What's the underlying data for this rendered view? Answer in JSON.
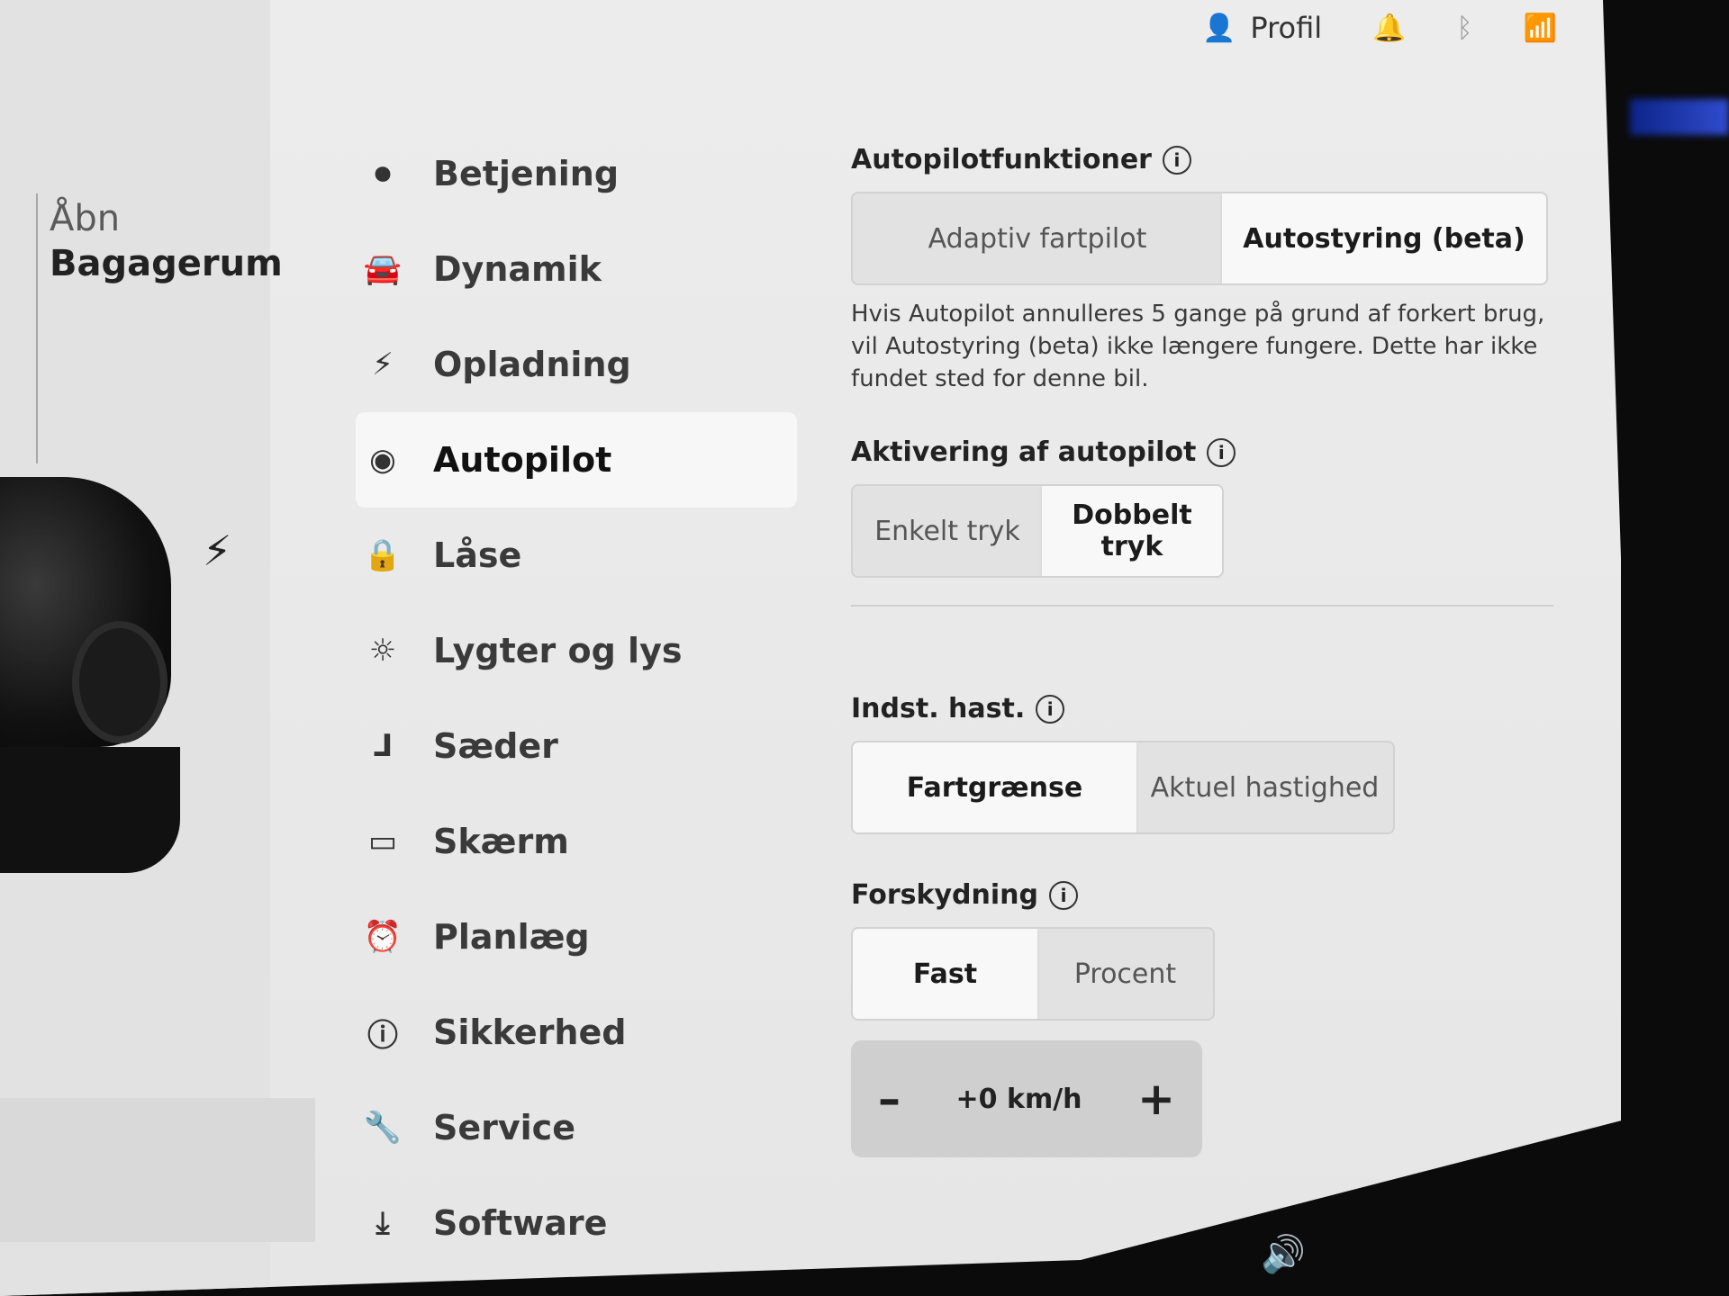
{
  "status": {
    "profile_icon": "person-icon",
    "profile_label": "Profil",
    "bell_icon": "bell-icon",
    "bluetooth_icon": "bluetooth-icon",
    "wifi_icon": "wifi-icon"
  },
  "left_panel": {
    "trunk_line1": "Åbn",
    "trunk_line2": "Bagagerum",
    "charge_icon": "lightning-icon"
  },
  "nav": {
    "items": [
      {
        "label": "Betjening",
        "icon": "toggle-icon"
      },
      {
        "label": "Dynamik",
        "icon": "car-icon"
      },
      {
        "label": "Opladning",
        "icon": "lightning-icon"
      },
      {
        "label": "Autopilot",
        "icon": "steering-wheel-icon",
        "active": true
      },
      {
        "label": "Låse",
        "icon": "lock-icon"
      },
      {
        "label": "Lygter og lys",
        "icon": "sun-icon"
      },
      {
        "label": "Sæder",
        "icon": "seat-icon"
      },
      {
        "label": "Skærm",
        "icon": "display-icon"
      },
      {
        "label": "Planlæg",
        "icon": "alarm-clock-icon"
      },
      {
        "label": "Sikkerhed",
        "icon": "alert-icon"
      },
      {
        "label": "Service",
        "icon": "wrench-icon"
      },
      {
        "label": "Software",
        "icon": "download-icon"
      }
    ]
  },
  "autopilot_features": {
    "title": "Autopilotfunktioner",
    "options": [
      "Adaptiv fartpilot",
      "Autostyring (beta)"
    ],
    "selected": "Autostyring (beta)",
    "note": "Hvis Autopilot annulleres 5 gange på grund af forkert brug, vil Autostyring (beta) ikke længere fungere. Dette har ikke fundet sted for denne bil."
  },
  "activation": {
    "title": "Aktivering af autopilot",
    "options": [
      "Enkelt tryk",
      "Dobbelt tryk"
    ],
    "selected": "Dobbelt tryk"
  },
  "set_speed": {
    "title": "Indst. hast.",
    "options": [
      "Fartgrænse",
      "Aktuel hastighed"
    ],
    "selected": "Fartgrænse"
  },
  "offset": {
    "title": "Forskydning",
    "options": [
      "Fast",
      "Procent"
    ],
    "selected": "Fast",
    "value": "+0 km/h",
    "minus": "–",
    "plus": "+"
  },
  "bottom": {
    "volume_icon": "speaker-icon"
  }
}
